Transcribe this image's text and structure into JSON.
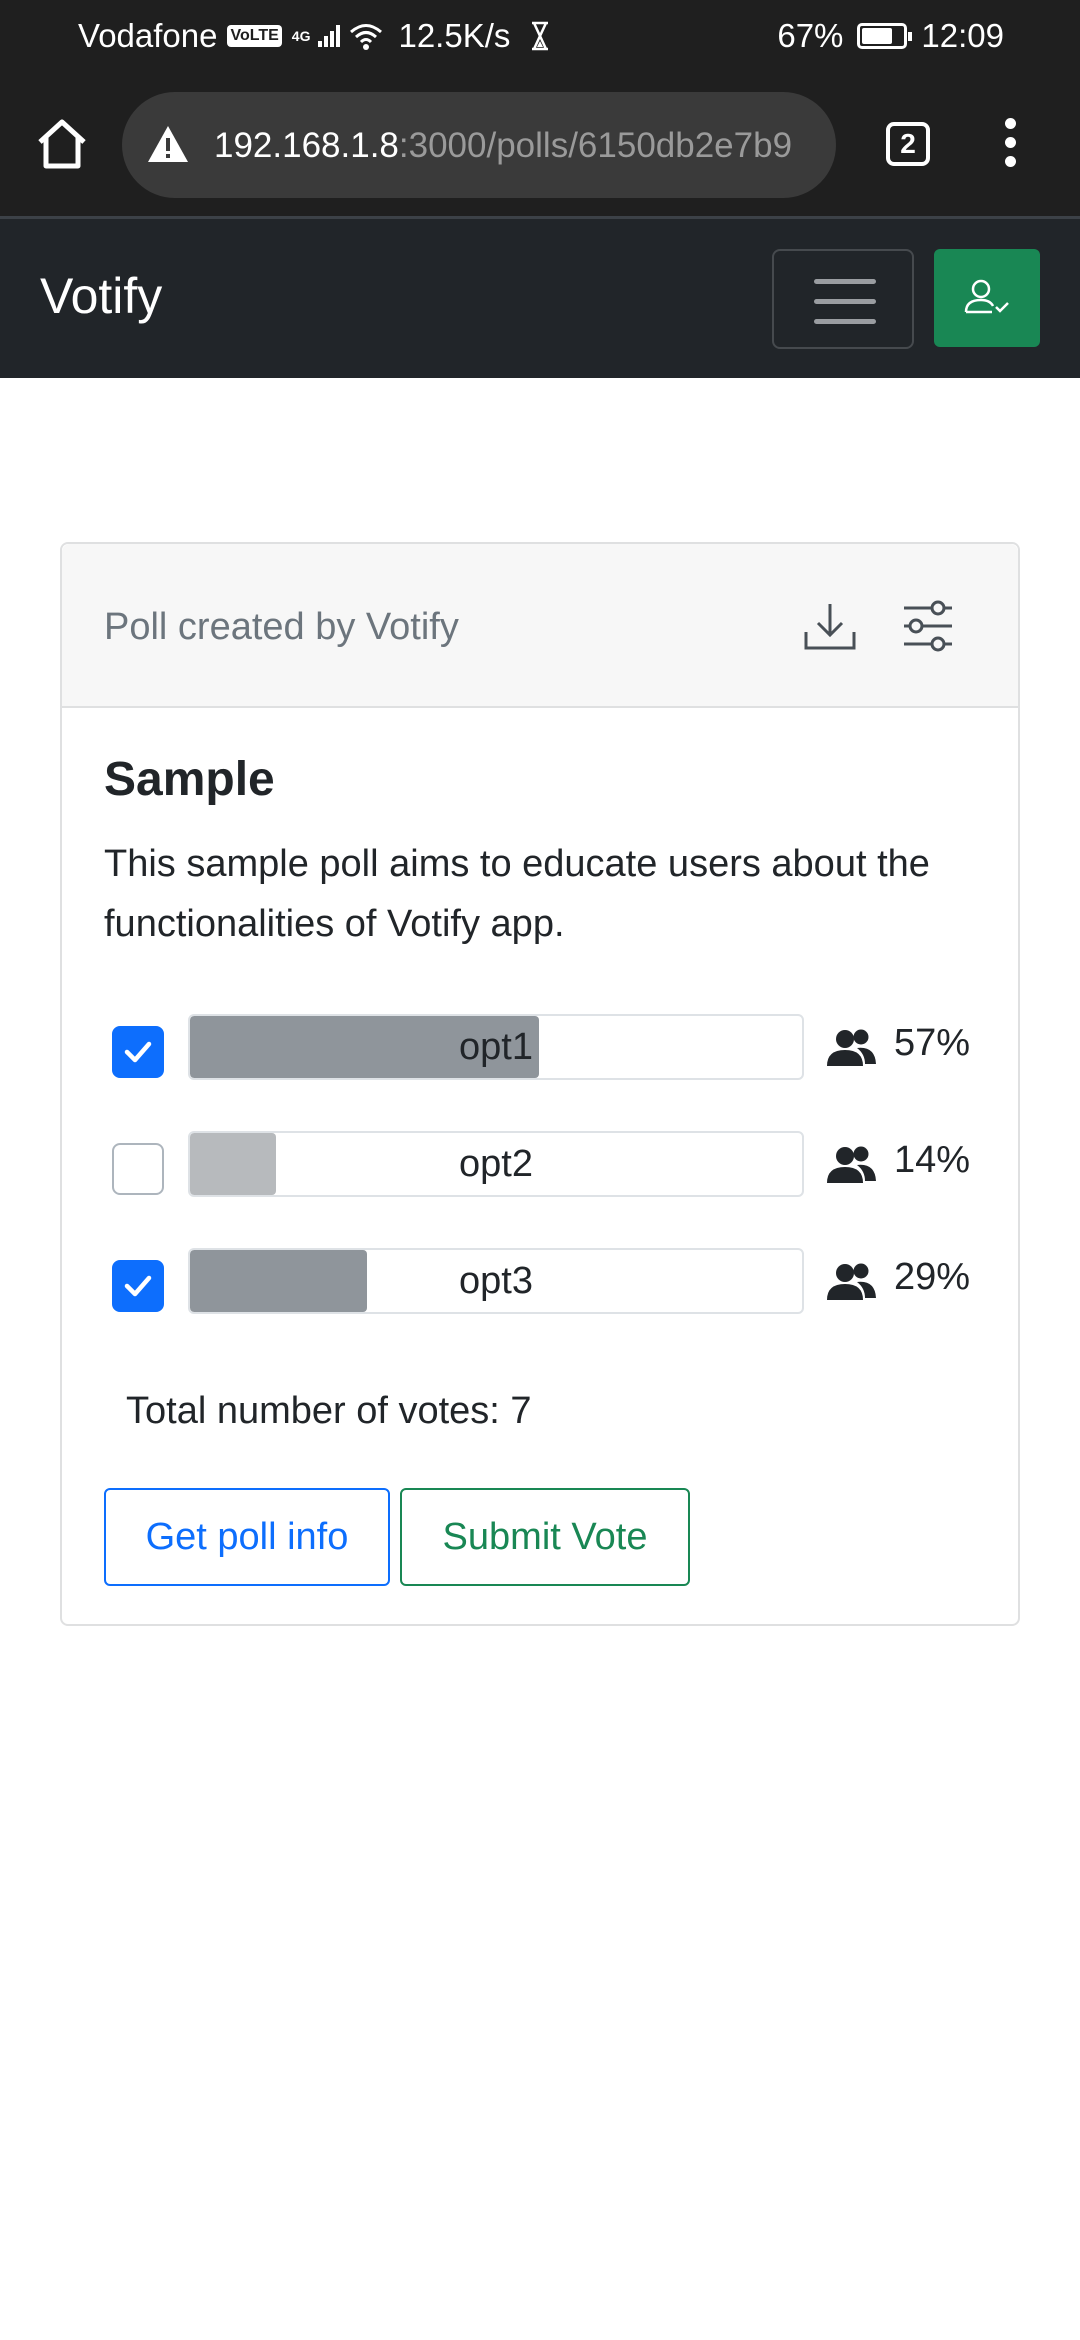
{
  "statusbar": {
    "carrier": "Vodafone",
    "volte": "VoLTE",
    "network": "4G",
    "speed": "12.5K/s",
    "battery": "67%",
    "time": "12:09"
  },
  "browser": {
    "url_host": "192.168.1.8",
    "url_rest": ":3000/polls/6150db2e7b9",
    "tab_count": "2"
  },
  "navbar": {
    "brand": "Votify"
  },
  "poll": {
    "created_by": "Poll created by Votify",
    "title": "Sample",
    "description": "This sample poll aims to educate users about the functionalities of Votify app.",
    "options": [
      {
        "label": "opt1",
        "percent": "57%",
        "fill_fraction": 0.57,
        "checked": true,
        "fill_color": "#8f959b"
      },
      {
        "label": "opt2",
        "percent": "14%",
        "fill_fraction": 0.14,
        "checked": false,
        "fill_color": "#b7babd"
      },
      {
        "label": "opt3",
        "percent": "29%",
        "fill_fraction": 0.29,
        "checked": true,
        "fill_color": "#8f959b"
      }
    ],
    "total_votes": "Total number of votes: 7",
    "info_button": "Get poll info",
    "submit_button": "Submit Vote"
  },
  "colors": {
    "primary": "#0d6efd",
    "success": "#198754",
    "navbar_bg": "#212529"
  }
}
